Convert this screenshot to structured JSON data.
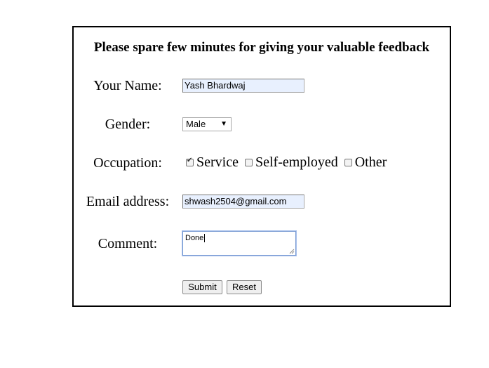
{
  "form": {
    "title": "Please spare few minutes for giving your valuable feedback",
    "name_label": "Your Name:",
    "name_value": "Yash Bhardwaj",
    "gender_label": "Gender:",
    "gender_value": "Male",
    "occupation_label": "Occupation:",
    "occupation_options": [
      {
        "label": "Service",
        "checked": true
      },
      {
        "label": "Self-employed",
        "checked": false
      },
      {
        "label": "Other",
        "checked": false
      }
    ],
    "email_label": "Email address:",
    "email_value": "shwash2504@gmail.com",
    "comment_label": "Comment:",
    "comment_value": "Done",
    "submit_label": "Submit",
    "reset_label": "Reset"
  },
  "colors": {
    "autofill_background": "#e8f0fe",
    "focus_border": "#7a9cd3"
  }
}
